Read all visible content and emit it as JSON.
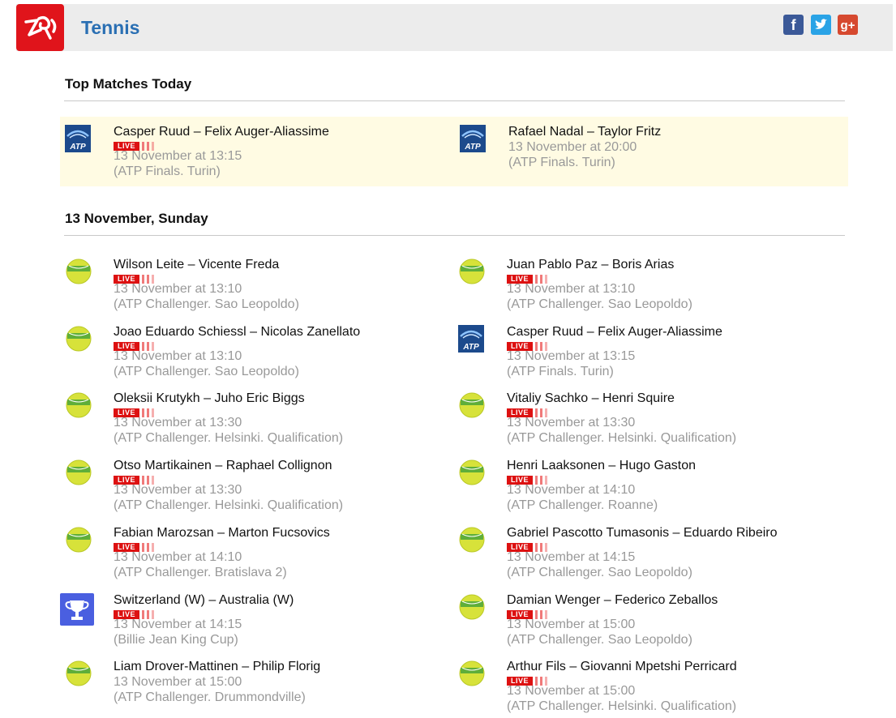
{
  "header": {
    "title": "Tennis",
    "social": [
      "facebook-icon",
      "twitter-icon",
      "google-plus-icon"
    ]
  },
  "colors": {
    "brand_red": "#e0141b",
    "title_blue": "#2a6fb3",
    "highlight_bg": "#fffbe3",
    "muted_text": "#999999",
    "live_red": "#dd1111"
  },
  "top_section": {
    "title": "Top Matches Today",
    "matches": [
      {
        "icon": "atp-icon",
        "players": "Casper Ruud – Felix Auger-Aliassime",
        "live": true,
        "live_label": "LIVE",
        "time": "13 November at 13:15",
        "tournament": "(ATP Finals. Turin)"
      },
      {
        "icon": "atp-icon",
        "players": "Rafael Nadal – Taylor Fritz",
        "live": false,
        "time": "13 November at 20:00",
        "tournament": "(ATP Finals. Turin)"
      }
    ]
  },
  "day_section": {
    "title": "13 November, Sunday",
    "matches": [
      {
        "icon": "tennis-ball-icon",
        "players": "Wilson Leite – Vicente Freda",
        "live": true,
        "live_label": "LIVE",
        "time": "13 November at 13:10",
        "tournament": "(ATP Challenger. Sao Leopoldo)"
      },
      {
        "icon": "tennis-ball-icon",
        "players": "Juan Pablo Paz – Boris Arias",
        "live": true,
        "live_label": "LIVE",
        "time": "13 November at 13:10",
        "tournament": "(ATP Challenger. Sao Leopoldo)"
      },
      {
        "icon": "tennis-ball-icon",
        "players": "Joao Eduardo Schiessl – Nicolas Zanellato",
        "live": true,
        "live_label": "LIVE",
        "time": "13 November at 13:10",
        "tournament": "(ATP Challenger. Sao Leopoldo)"
      },
      {
        "icon": "atp-icon",
        "players": "Casper Ruud – Felix Auger-Aliassime",
        "live": true,
        "live_label": "LIVE",
        "time": "13 November at 13:15",
        "tournament": "(ATP Finals. Turin)"
      },
      {
        "icon": "tennis-ball-icon",
        "players": "Oleksii Krutykh – Juho Eric Biggs",
        "live": true,
        "live_label": "LIVE",
        "time": "13 November at 13:30",
        "tournament": "(ATP Challenger. Helsinki. Qualification)"
      },
      {
        "icon": "tennis-ball-icon",
        "players": "Vitaliy Sachko – Henri Squire",
        "live": true,
        "live_label": "LIVE",
        "time": "13 November at 13:30",
        "tournament": "(ATP Challenger. Helsinki. Qualification)"
      },
      {
        "icon": "tennis-ball-icon",
        "players": "Otso Martikainen – Raphael Collignon",
        "live": true,
        "live_label": "LIVE",
        "time": "13 November at 13:30",
        "tournament": "(ATP Challenger. Helsinki. Qualification)"
      },
      {
        "icon": "tennis-ball-icon",
        "players": "Henri Laaksonen – Hugo Gaston",
        "live": true,
        "live_label": "LIVE",
        "time": "13 November at 14:10",
        "tournament": "(ATP Challenger. Roanne)"
      },
      {
        "icon": "tennis-ball-icon",
        "players": "Fabian Marozsan – Marton Fucsovics",
        "live": true,
        "live_label": "LIVE",
        "time": "13 November at 14:10",
        "tournament": "(ATP Challenger. Bratislava 2)"
      },
      {
        "icon": "tennis-ball-icon",
        "players": "Gabriel Pascotto Tumasonis – Eduardo Ribeiro",
        "live": true,
        "live_label": "LIVE",
        "time": "13 November at 14:15",
        "tournament": "(ATP Challenger. Sao Leopoldo)"
      },
      {
        "icon": "cup-icon",
        "players": "Switzerland (W) – Australia (W)",
        "live": true,
        "live_label": "LIVE",
        "time": "13 November at 14:15",
        "tournament": "(Billie Jean King Cup)"
      },
      {
        "icon": "tennis-ball-icon",
        "players": "Damian Wenger – Federico Zeballos",
        "live": true,
        "live_label": "LIVE",
        "time": "13 November at 15:00",
        "tournament": "(ATP Challenger. Sao Leopoldo)"
      },
      {
        "icon": "tennis-ball-icon",
        "players": "Liam Drover-Mattinen – Philip Florig",
        "live": false,
        "time": "13 November at 15:00",
        "tournament": "(ATP Challenger. Drummondville)"
      },
      {
        "icon": "tennis-ball-icon",
        "players": "Arthur Fils – Giovanni Mpetshi Perricard",
        "live": true,
        "live_label": "LIVE",
        "time": "13 November at 15:00",
        "tournament": "(ATP Challenger. Helsinki. Qualification)"
      }
    ]
  }
}
